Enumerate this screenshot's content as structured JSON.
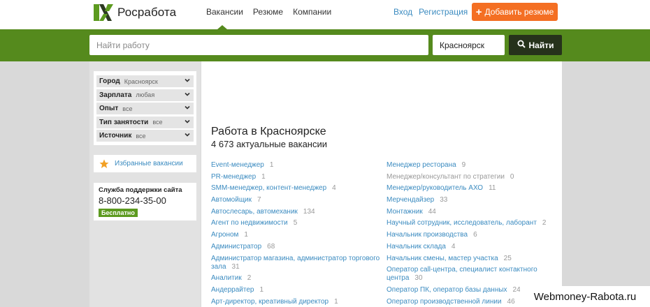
{
  "header": {
    "logo_text": "Росработа",
    "nav": [
      "Вакансии",
      "Резюме",
      "Компании"
    ],
    "auth": {
      "login": "Вход",
      "register": "Регистрация"
    },
    "add_resume": "Добавить резюме"
  },
  "search": {
    "placeholder": "Найти работу",
    "city": "Красноярск",
    "button": "Найти"
  },
  "sidebar": {
    "filters": [
      {
        "name": "Город",
        "value": "Красноярск"
      },
      {
        "name": "Зарплата",
        "value": "любая"
      },
      {
        "name": "Опыт",
        "value": "все"
      },
      {
        "name": "Тип занятости",
        "value": "все"
      },
      {
        "name": "Источник",
        "value": "все"
      }
    ],
    "favorites": "Избранные вакансии",
    "support": {
      "title": "Служба поддержки сайта",
      "phone": "8-800-234-35-00",
      "badge": "Бесплатно"
    }
  },
  "main": {
    "title": "Работа в Красноярске",
    "subtitle": "4 673 актуальные вакансии",
    "left": [
      {
        "name": "Event-менеджер",
        "count": "1"
      },
      {
        "name": "PR-менеджер",
        "count": "1"
      },
      {
        "name": "SMM-менеджер, контент-менеджер",
        "count": "4"
      },
      {
        "name": "Автомойщик",
        "count": "7"
      },
      {
        "name": "Автослесарь, автомеханик",
        "count": "134"
      },
      {
        "name": "Агент по недвижимости",
        "count": "5"
      },
      {
        "name": "Агроном",
        "count": "1"
      },
      {
        "name": "Администратор",
        "count": "68"
      },
      {
        "name": "Администратор магазина, администратор торгового зала",
        "count": "31"
      },
      {
        "name": "Аналитик",
        "count": "2"
      },
      {
        "name": "Андеррайтер",
        "count": "1"
      },
      {
        "name": "Арт-директор, креативный директор",
        "count": "1"
      }
    ],
    "right": [
      {
        "name": "Менеджер ресторана",
        "count": "9"
      },
      {
        "name": "Менеджер/консультант по стратегии",
        "count": "0",
        "muted": true
      },
      {
        "name": "Менеджер/руководитель АХО",
        "count": "11"
      },
      {
        "name": "Мерчендайзер",
        "count": "33"
      },
      {
        "name": "Монтажник",
        "count": "44"
      },
      {
        "name": "Научный сотрудник, исследователь, лаборант",
        "count": "2"
      },
      {
        "name": "Начальник производства",
        "count": "6"
      },
      {
        "name": "Начальник склада",
        "count": "4"
      },
      {
        "name": "Начальник смены, мастер участка",
        "count": "25"
      },
      {
        "name": "Оператор call-центра, специалист контактного центра",
        "count": "30"
      },
      {
        "name": "Оператор ПК, оператор базы данных",
        "count": "24"
      },
      {
        "name": "Оператор производственной линии",
        "count": "46"
      }
    ]
  },
  "watermark": "Webmoney-Rabota.ru",
  "colors": {
    "brand_green": "#558a1d",
    "accent_orange": "#f46f23",
    "link_blue": "#3b8bc0"
  }
}
